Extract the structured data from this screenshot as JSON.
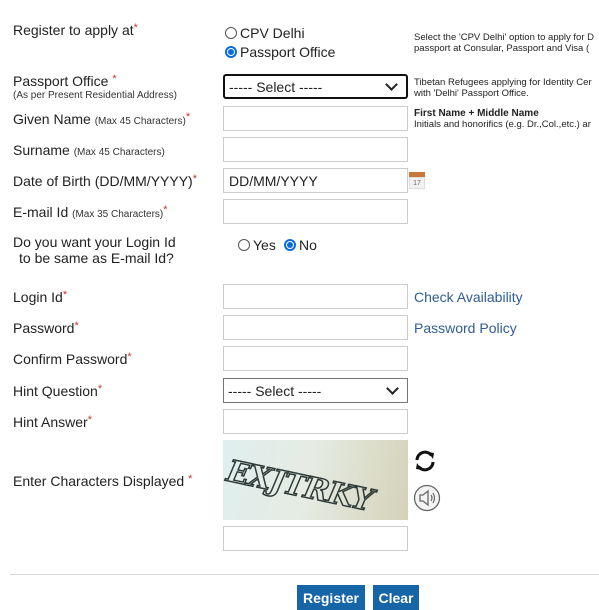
{
  "register_at": {
    "label": "Register to apply at",
    "options": [
      "CPV Delhi",
      "Passport Office"
    ],
    "selected": "Passport Office",
    "hint_line1": "Select the 'CPV Delhi' option to apply for D",
    "hint_line2": "passport at Consular, Passport and Visa ("
  },
  "passport_office": {
    "label": "Passport Office",
    "sublabel": "(As per Present Residential Address)",
    "value": "----- Select -----",
    "hint_line1": "Tibetan Refugees applying for Identity Cer",
    "hint_line2": "with 'Delhi' Passport Office."
  },
  "given_name": {
    "label": "Given Name",
    "sublabel": "(Max 45 Characters)",
    "value": "",
    "hint_title": "First Name + Middle Name",
    "hint_text": "Initials and honorifics (e.g. Dr.,Col.,etc.) ar"
  },
  "surname": {
    "label": "Surname",
    "sublabel": "(Max 45 Characters)",
    "value": ""
  },
  "dob": {
    "label": "Date of Birth (DD/MM/YYYY)",
    "value": "DD/MM/YYYY",
    "calendar_day": "17"
  },
  "email": {
    "label": "E-mail Id",
    "sublabel": "(Max 35 Characters)",
    "value": ""
  },
  "login_same": {
    "label_line1": "Do you want your Login Id",
    "label_line2": "to be same as E-mail Id?",
    "options": [
      "Yes",
      "No"
    ],
    "selected": "No"
  },
  "login_id": {
    "label": "Login Id",
    "value": "",
    "link": "Check Availability"
  },
  "password": {
    "label": "Password",
    "value": "",
    "link": "Password Policy"
  },
  "confirm_password": {
    "label": "Confirm Password",
    "value": ""
  },
  "hint_question": {
    "label": "Hint Question",
    "value": "----- Select -----"
  },
  "hint_answer": {
    "label": "Hint Answer",
    "value": ""
  },
  "captcha": {
    "label": "Enter Characters Displayed",
    "image_text": "EXJTRKY",
    "value": ""
  },
  "required_mark": "*",
  "buttons": {
    "register": "Register",
    "clear": "Clear"
  }
}
